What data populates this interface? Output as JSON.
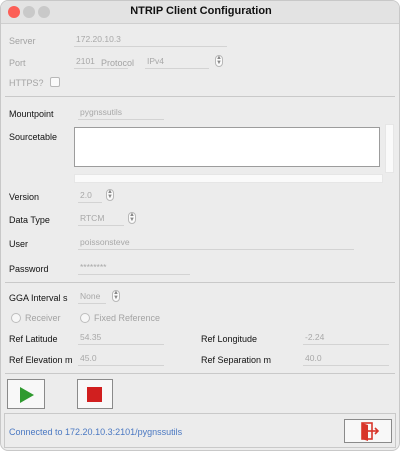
{
  "window": {
    "title": "NTRIP Client Configuration"
  },
  "server": {
    "server_label": "Server",
    "server_value": "172.20.10.3",
    "port_label": "Port",
    "port_value": "2101",
    "protocol_label": "Protocol",
    "protocol_value": "IPv4",
    "https_label": "HTTPS?",
    "https_checked": false
  },
  "mountpoint": {
    "mountpoint_label": "Mountpoint",
    "mountpoint_value": "pygnssutils",
    "sourcetable_label": "Sourcetable",
    "version_label": "Version",
    "version_value": "2.0",
    "datatype_label": "Data Type",
    "datatype_value": "RTCM",
    "user_label": "User",
    "user_value": "poissonsteve",
    "password_label": "Password",
    "password_value": "********"
  },
  "gga": {
    "interval_label": "GGA Interval s",
    "interval_value": "None",
    "receiver_label": "Receiver",
    "fixed_label": "Fixed Reference",
    "lat_label": "Ref Latitude",
    "lat_value": "54.35",
    "lon_label": "Ref Longitude",
    "lon_value": "-2.24",
    "elev_label": "Ref Elevation m",
    "elev_value": "45.0",
    "sep_label": "Ref Separation m",
    "sep_value": "40.0"
  },
  "status": {
    "message": "Connected to 172.20.10.3:2101/pygnssutils"
  },
  "colors": {
    "play": "#2f9a2f",
    "stop": "#d11f1f",
    "status_text": "#4a78c2",
    "exit": "#d8352a"
  },
  "icons": {
    "connect": "play-icon",
    "disconnect": "stop-icon",
    "exit": "exit-icon"
  }
}
